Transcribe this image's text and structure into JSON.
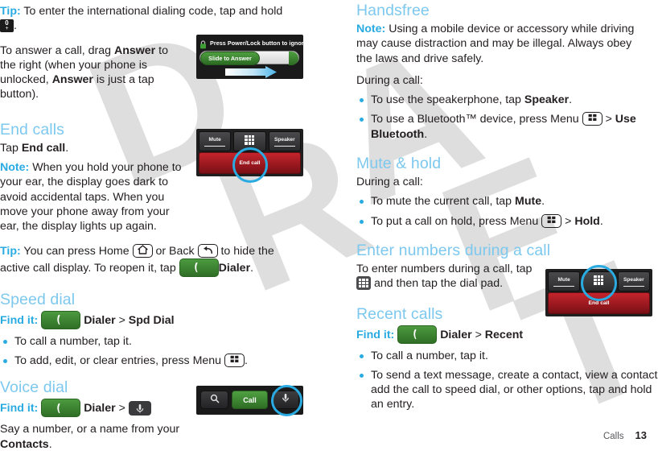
{
  "document": {
    "footer_section": "Calls",
    "footer_page": "13"
  },
  "left_column": {
    "tip_1": {
      "label": "Tip:",
      "text_before": " To enter the international dialing code, tap and hold ",
      "key_icon": "zero-plus-key-icon",
      "text_after": "."
    },
    "answer_paragraph": {
      "part1": "To answer a call, drag ",
      "bold1": "Answer",
      "part2": " to the right (when your phone is unlocked, ",
      "bold2": "Answer",
      "part3": " is just a tap button)."
    },
    "end_calls": {
      "heading": "End calls",
      "tap_line_prefix": "Tap ",
      "tap_line_bold": "End call",
      "tap_line_suffix": ".",
      "note_label": "Note:",
      "note_text": " When you hold your phone to your ear, the display goes dark to avoid accidental taps. When you move your phone away from your ear, the display lights up again.",
      "tip_label": "Tip:",
      "tip_part1": " You can press Home ",
      "tip_home_icon": "home-key-icon",
      "tip_part2": " or Back ",
      "tip_back_icon": "back-key-icon",
      "tip_part3": " to hide the active call display. To reopen it, tap ",
      "tip_dialer_icon": "dialer-button-icon",
      "tip_bold": "Dialer",
      "tip_part4": "."
    },
    "speed_dial": {
      "heading": "Speed dial",
      "find_it_label": "Find it:",
      "find_it_icon": "dialer-button-icon",
      "find_it_bold1": "Dialer",
      "find_it_sep": " > ",
      "find_it_bold2": "Spd Dial",
      "bullets": [
        {
          "text": "To call a number, tap it."
        },
        {
          "text_before": "To add, edit, or clear entries, press Menu ",
          "icon": "menu-key-icon",
          "text_after": "."
        }
      ]
    },
    "voice_dial": {
      "heading": "Voice dial",
      "find_it_label": "Find it:",
      "find_it_icon": "dialer-button-icon",
      "find_it_bold1": "Dialer",
      "find_it_sep": " > ",
      "find_it_chip": "voice-dial-chip-icon",
      "say_part1": "Say a number, or a name from your ",
      "say_bold": "Contacts",
      "say_part2": "."
    }
  },
  "right_column": {
    "handsfree": {
      "heading": "Handsfree",
      "note_label": "Note:",
      "note_text": " Using a mobile device or accessory while driving may cause distraction and may be illegal. Always obey the laws and drive safely.",
      "during_a_call": "During a call:",
      "bullets": [
        {
          "text_before": "To use the speakerphone, tap ",
          "bold": "Speaker",
          "text_after": "."
        },
        {
          "text_before": "To use a Bluetooth™ device, press Menu ",
          "icon": "menu-key-icon",
          "mid": " > ",
          "bold": "Use Bluetooth",
          "text_after": "."
        }
      ]
    },
    "mute_hold": {
      "heading": "Mute & hold",
      "during_a_call": "During a call:",
      "bullets": [
        {
          "text_before": "To mute the current call, tap ",
          "bold": "Mute",
          "text_after": "."
        },
        {
          "text_before": "To put a call on hold, press Menu ",
          "icon": "menu-key-icon",
          "mid": " > ",
          "bold": "Hold",
          "text_after": "."
        }
      ]
    },
    "enter_numbers": {
      "heading": "Enter numbers during a call",
      "part1": "To enter numbers during a call, tap ",
      "icon": "dialpad-chip-icon",
      "part2": " and then tap the dial pad."
    },
    "recent_calls": {
      "heading": "Recent calls",
      "find_it_label": "Find it:",
      "find_it_icon": "dialer-button-icon",
      "find_it_bold1": "Dialer",
      "find_it_sep": " > ",
      "find_it_bold2": "Recent",
      "bullets": [
        {
          "text": "To call a number, tap it."
        },
        {
          "text": "To send a text message, create a contact, view a contact, add the call to speed dial, or other options, tap and hold an entry."
        }
      ]
    }
  },
  "figures": {
    "incoming_call": {
      "name": "incoming-call-screenshot",
      "status_text": "Press Power/Lock button to ignore",
      "lock_icon": "lock-icon",
      "slider_label": "Slide to Answer",
      "drag_arrow_icon": "drag-right-arrow-icon"
    },
    "in_call_end": {
      "name": "in-call-bar-end-call-screenshot",
      "mute_label": "Mute",
      "dialpad_icon": "dialpad-icon",
      "speaker_label": "Speaker",
      "end_call_label": "End call",
      "highlight": "end-call-button"
    },
    "in_call_dialpad": {
      "name": "in-call-bar-dialpad-screenshot",
      "mute_label": "Mute",
      "dialpad_icon": "dialpad-icon",
      "speaker_label": "Speaker",
      "end_call_label": "End call",
      "highlight": "dialpad-button"
    },
    "voice_dial_bar": {
      "name": "voice-dial-bar-screenshot",
      "search_icon": "search-icon",
      "call_label": "Call",
      "mic_icon": "microphone-icon",
      "highlight": "voice-dial-button"
    }
  },
  "watermark": {
    "text": "DRAFT",
    "color": "#d9d9d9"
  },
  "colors": {
    "accent_blue": "#29abe2",
    "heading_blue": "#7dc8ef",
    "green": "#3f8a33",
    "red": "#b21f27",
    "dark": "#1f1f1f"
  }
}
